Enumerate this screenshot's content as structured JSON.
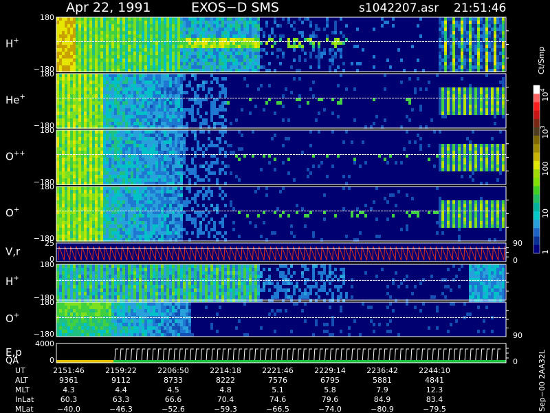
{
  "header": {
    "date": "Apr 22, 1991",
    "instrument": "EXOS−D SMS",
    "file": "s1042207.asr",
    "time": "21:51:46"
  },
  "footer_side_text": "Sep−00 2AA32L",
  "colorbar": {
    "unit": "Ct/Smp",
    "ticks": [
      "1",
      "10",
      "100",
      "10",
      "10"
    ],
    "tick_exps": [
      "",
      "",
      "",
      "3",
      "4"
    ],
    "colors": [
      "#000080",
      "#0a3296",
      "#1e64c8",
      "#28a0dc",
      "#00c8c8",
      "#00b4a0",
      "#20c060",
      "#40d020",
      "#80e000",
      "#a0dc00",
      "#e0e800",
      "#c8b400",
      "#a08c00",
      "#806800",
      "#503c1e",
      "#782814",
      "#c81414",
      "#ff1e1e",
      "#ff6464",
      "#ffffff"
    ]
  },
  "chart_data": {
    "type": "heatmap",
    "panels": [
      {
        "label": "H",
        "sup": "+",
        "y_top": "180",
        "y_bot": "−180",
        "activity": "h1"
      },
      {
        "label": "He",
        "sup": "+",
        "y_top": "180",
        "y_bot": "−180",
        "activity": "he"
      },
      {
        "label": "O",
        "sup": "++",
        "y_top": "180",
        "y_bot": "−180",
        "activity": "opp"
      },
      {
        "label": "O",
        "sup": "+",
        "y_top": "180",
        "y_bot": "−180",
        "activity": "op"
      },
      {
        "label": "V,r",
        "sup": "",
        "y_top": "25",
        "y_bot": "0",
        "right_top": "90",
        "right_bot": "0",
        "activity": "vr"
      },
      {
        "label": "H",
        "sup": "+",
        "y_top": "180",
        "y_bot": "−180",
        "activity": "h2"
      },
      {
        "label": "O",
        "sup": "+",
        "y_top": "180",
        "y_bot": "−180",
        "right_bot": "90",
        "activity": "o2"
      },
      {
        "label": "E,p",
        "label2": "QA",
        "sup": "",
        "y_top": "4000",
        "y_bot": "0",
        "right_bot": "0",
        "activity": "ep"
      }
    ],
    "ephemeris": {
      "labels": [
        "UT",
        "ALT",
        "MLT",
        "InLat",
        "MLat"
      ],
      "columns": [
        [
          "2151:46",
          "9361",
          "4.3",
          "60.3",
          "−40.0"
        ],
        [
          "2159:22",
          "9112",
          "4.4",
          "63.3",
          "−46.3"
        ],
        [
          "2206:50",
          "8733",
          "4.5",
          "66.6",
          "−52.6"
        ],
        [
          "2214:18",
          "8222",
          "4.8",
          "70.4",
          "−59.3"
        ],
        [
          "2221:46",
          "7576",
          "5.1",
          "74.6",
          "−66.5"
        ],
        [
          "2229:14",
          "6795",
          "5.8",
          "79.6",
          "−74.0"
        ],
        [
          "2236:42",
          "5881",
          "7.9",
          "84.9",
          "−80.9"
        ],
        [
          "2244:10",
          "4841",
          "12.3",
          "83.4",
          "−79.5"
        ]
      ]
    }
  }
}
